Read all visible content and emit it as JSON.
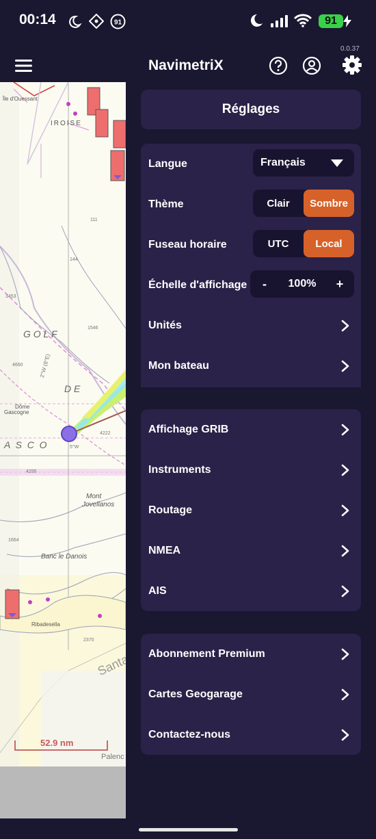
{
  "status": {
    "time": "00:14",
    "battery": "91"
  },
  "app": {
    "title": "NavimetriX",
    "version": "0.0.37"
  },
  "map": {
    "scale_label": "52.9 nm",
    "labels": {
      "douessant": "Île d'Ouessant",
      "iroise": "IROISE",
      "golf": "G  O  L  F",
      "de": "D  E",
      "gascogne": "A  S  C  O",
      "mont": "Mont",
      "jovellanos": "Jovellanos",
      "banc": "Banc le Danois",
      "santa": "Santa",
      "palenc": "Palenc",
      "ribadesella": "Ribadesella",
      "meridian": "2°W (8°E)",
      "dome": "Dôme",
      "gascogne2": "Gascogne",
      "soundings": [
        "111",
        "144",
        "1546",
        "4660",
        "4222",
        "4295",
        "3453",
        "1664",
        "2370",
        "5°W"
      ]
    }
  },
  "settings": {
    "title": "Réglages",
    "general": {
      "langue_label": "Langue",
      "langue_value": "Français",
      "theme_label": "Thème",
      "theme_options": [
        "Clair",
        "Sombre"
      ],
      "theme_selected": "Sombre",
      "tz_label": "Fuseau horaire",
      "tz_options": [
        "UTC",
        "Local"
      ],
      "tz_selected": "Local",
      "scale_label": "Échelle d'affichage",
      "scale_minus": "-",
      "scale_value": "100%",
      "scale_plus": "+",
      "units_label": "Unités",
      "boat_label": "Mon bateau"
    },
    "data": {
      "grib_label": "Affichage GRIB",
      "instruments_label": "Instruments",
      "routing_label": "Routage",
      "nmea_label": "NMEA",
      "ais_label": "AIS"
    },
    "account": {
      "premium_label": "Abonnement Premium",
      "geogarage_label": "Cartes Geogarage",
      "contact_label": "Contactez-nous"
    }
  }
}
